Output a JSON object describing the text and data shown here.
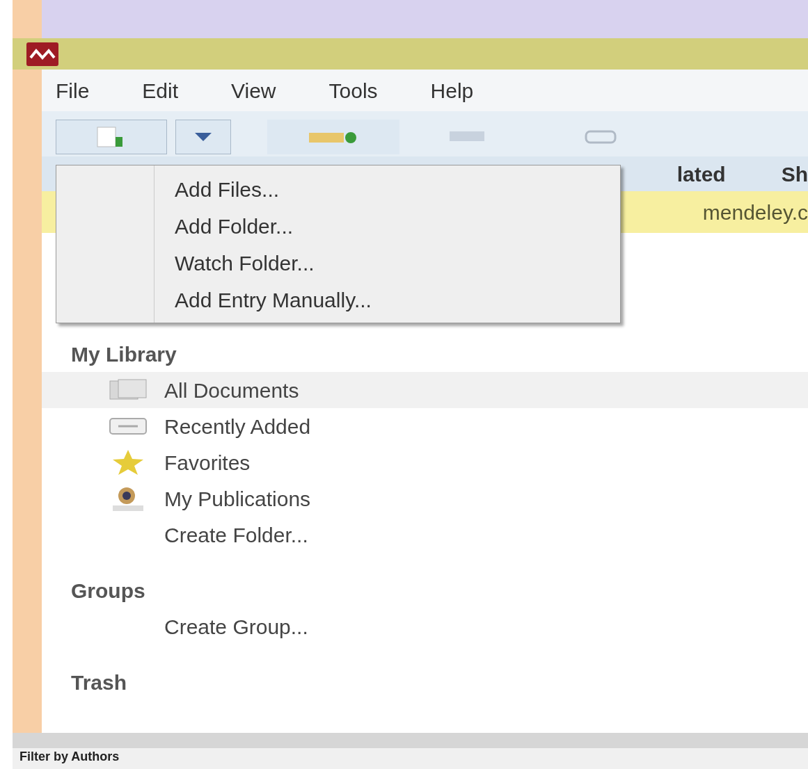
{
  "menu_bar": [
    {
      "label": "File"
    },
    {
      "label": "Edit"
    },
    {
      "label": "View"
    },
    {
      "label": "Tools"
    },
    {
      "label": "Help"
    }
  ],
  "column_headers": [
    {
      "label": "lated"
    },
    {
      "label": "Sh"
    }
  ],
  "notification": {
    "text": "mendeley.c"
  },
  "dropdown_menu": [
    {
      "label": "Add Files..."
    },
    {
      "label": "Add Folder..."
    },
    {
      "label": "Watch Folder..."
    },
    {
      "label": "Add Entry Manually..."
    }
  ],
  "sidebar": {
    "sections": [
      {
        "title": "My Library",
        "items": [
          {
            "label": "All Documents",
            "kind": "docs",
            "selected": true
          },
          {
            "label": "Recently Added",
            "kind": "recent",
            "selected": false
          },
          {
            "label": "Favorites",
            "kind": "star",
            "selected": false
          },
          {
            "label": "My Publications",
            "kind": "person",
            "selected": false
          },
          {
            "label": "Create Folder...",
            "kind": "plain",
            "selected": false
          }
        ]
      },
      {
        "title": "Groups",
        "items": [
          {
            "label": "Create Group...",
            "kind": "plain",
            "selected": false
          }
        ]
      },
      {
        "title": "Trash"
      }
    ]
  },
  "filter_label": "Filter by Authors"
}
